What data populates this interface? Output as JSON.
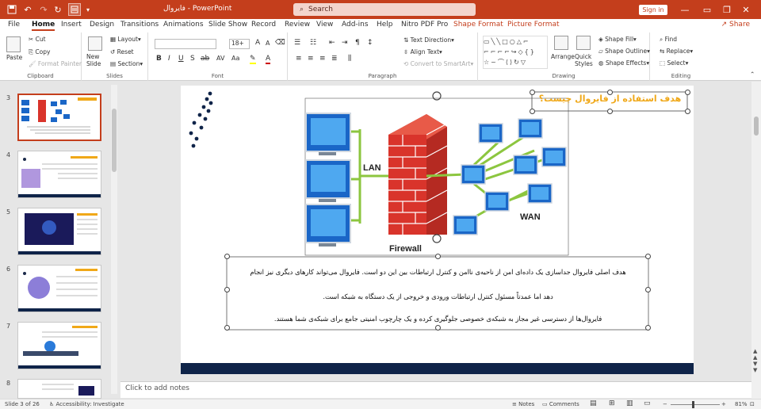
{
  "app": {
    "document_name": "فایروال",
    "separator": "-",
    "app_name": "PowerPoint",
    "search_placeholder": "Search",
    "signin_label": "Sign in",
    "share_label": "Share"
  },
  "tabs": [
    "File",
    "Home",
    "Insert",
    "Design",
    "Transitions",
    "Animations",
    "Slide Show",
    "Record",
    "Review",
    "View",
    "Add-ins",
    "Help",
    "Nitro PDF Pro",
    "Shape Format",
    "Picture Format"
  ],
  "active_tab": "Home",
  "ribbon": {
    "clipboard": {
      "label": "Clipboard",
      "paste": "Paste",
      "cut": "Cut",
      "copy": "Copy",
      "format_painter": "Format Painter"
    },
    "slides": {
      "label": "Slides",
      "new_slide": "New Slide",
      "layout": "Layout",
      "reset": "Reset",
      "section": "Section"
    },
    "font": {
      "label": "Font",
      "font_name": "",
      "font_size": "18+"
    },
    "paragraph": {
      "label": "Paragraph",
      "text_direction": "Text Direction",
      "align_text": "Align Text",
      "convert_smartart": "Convert to SmartArt"
    },
    "drawing": {
      "label": "Drawing",
      "arrange": "Arrange",
      "quick_styles": "Quick Styles",
      "shape_fill": "Shape Fill",
      "shape_outline": "Shape Outline",
      "shape_effects": "Shape Effects"
    },
    "editing": {
      "label": "Editing",
      "find": "Find",
      "replace": "Replace",
      "select": "Select"
    }
  },
  "slides_panel": {
    "numbers": [
      "3",
      "4",
      "5",
      "6",
      "7",
      "8"
    ],
    "selected": "3"
  },
  "slide": {
    "title": "هدف استفاده از فایروال چیست؟",
    "lan_label": "LAN",
    "wan_label": "WAN",
    "firewall_label": "Firewall",
    "paragraph_lines": [
      "هدف اصلی فایروال جداسازی یک داده‌ای امن از ناحیه‌ی ناامن و کنترل ارتباطات بین این دو است. فایروال می‌تواند کارهای دیگری نیز انجام",
      "دهد اما عمدتاً مسئول کنترل ارتباطات ورودی و خروجی از یک دستگاه به شبکه است.",
      "فایروال‌ها از دسترسی غیر مجاز به شبکه‌ی خصوصی جلوگیری کرده و یک چارچوب امنیتی جامع برای شبکه‌ی شما هستند."
    ]
  },
  "notes_placeholder": "Click to add notes",
  "status": {
    "slide_info": "Slide 3 of 26",
    "accessibility": "Accessibility: Investigate",
    "notes": "Notes",
    "comments": "Comments",
    "zoom": "81%"
  },
  "colors": {
    "accent": "#c43e1c",
    "title_text": "#f0a818",
    "footer_bar": "#0f2449",
    "brick": "#d9342b",
    "monitor": "#1a66c7",
    "link": "#8cc63f"
  }
}
